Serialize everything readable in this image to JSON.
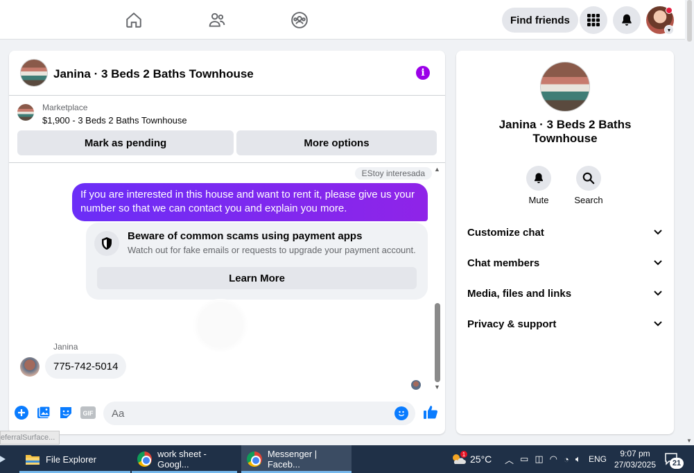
{
  "topbar": {
    "find_friends": "Find friends",
    "icons": [
      "home-icon",
      "friends-icon",
      "groups-icon",
      "menu-grid-icon",
      "notifications-icon"
    ]
  },
  "chat": {
    "title": "Janina · 3 Beds 2 Baths Townhouse",
    "marketplace": {
      "label": "Marketplace",
      "listing": "$1,900 - 3 Beds 2 Baths Townhouse",
      "mark_pending": "Mark as pending",
      "more_options": "More options"
    },
    "messages": {
      "seen_text": "EStoy interesada",
      "outgoing": "If you are interested in this house and want to rent it, please give us your number so that we can contact you and explain you more.",
      "scam_title": "Beware of common scams using payment apps",
      "scam_text": "Watch out for fake emails or requests to upgrade your payment account.",
      "learn_more": "Learn More",
      "sender_name": "Janina",
      "incoming": "775-742-5014"
    },
    "composer": {
      "placeholder": "Aa",
      "gif_label": "GIF"
    }
  },
  "info_panel": {
    "title": "Janina · 3 Beds 2 Baths Townhouse",
    "actions": {
      "mute": "Mute",
      "search": "Search"
    },
    "sections": [
      "Customize chat",
      "Chat members",
      "Media, files and links",
      "Privacy & support"
    ]
  },
  "referral_text": "eferralSurface...",
  "taskbar": {
    "file_explorer": "File Explorer",
    "chrome_1": "work sheet - Googl...",
    "chrome_2": "Messenger | Faceb...",
    "weather_badge": "1",
    "temperature": "25°C",
    "language": "ENG",
    "time": "9:07 pm",
    "date": "27/03/2025",
    "notifications_count": "21"
  },
  "colors": {
    "accent_purple": "#7b2cf2",
    "messenger_blue": "#0a7cff",
    "info_purple": "#9b00e8",
    "taskbar": "#1f3047"
  }
}
